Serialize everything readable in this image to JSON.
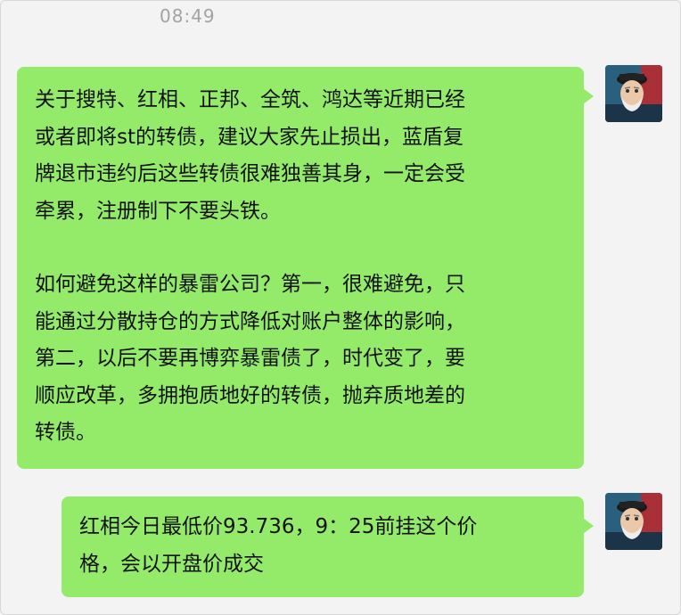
{
  "timestamp": "08:49",
  "messages": [
    {
      "paragraph1": "关于搜特、红相、正邦、全筑、鸿达等近期已经\n或者即将st的转债，建议大家先止损出，蓝盾复\n牌退市违约后这些转债很难独善其身，一定会受\n牵累，注册制下不要头铁。",
      "paragraph2": "如何避免这样的暴雷公司？第一，很难避免，只\n能通过分散持仓的方式降低对账户整体的影响，\n第二，以后不要再博弈暴雷债了，时代变了，要\n顺应改革，多拥抱质地好的转债，抛弃质地差的\n转债。"
    },
    {
      "text": "红相今日最低价93.736，9：25前挂这个价\n格，会以开盘价成交"
    }
  ],
  "colors": {
    "bubble": "#94eb6a",
    "background": "#f3f3f3",
    "timestamp": "#a3a3a3"
  }
}
